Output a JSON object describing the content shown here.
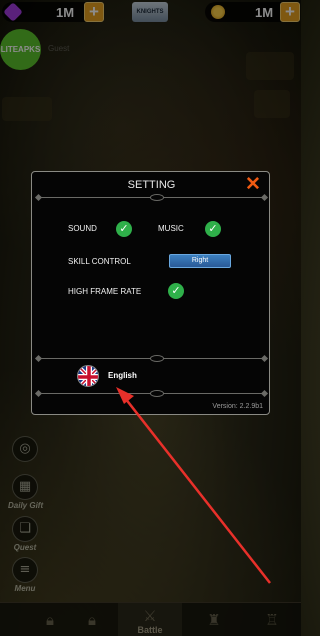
{
  "topbar": {
    "gems_value": "1M",
    "coins_value": "1M",
    "plus_label": "+",
    "logo_text": "KNIGHTS"
  },
  "watermark": {
    "text": "LITEAPKS"
  },
  "profile": {
    "guest_text": "Guest"
  },
  "side_menu": [
    {
      "label": "Daily Gift",
      "icon": "calendar-icon"
    },
    {
      "label": "Quest",
      "icon": "scroll-icon"
    },
    {
      "label": "Menu",
      "icon": "menu-icon"
    }
  ],
  "bottom_nav": {
    "battle_label": "Battle"
  },
  "dialog": {
    "title": "SETTING",
    "close_glyph": "✕",
    "sound_label": "SOUND",
    "music_label": "MUSIC",
    "skill_control_label": "SKILL CONTROL",
    "skill_control_value": "Right",
    "high_frame_rate_label": "HIGH FRAME RATE",
    "language": "English",
    "version": "Version: 2.2.9b1",
    "sound_enabled": true,
    "music_enabled": true,
    "high_frame_rate_enabled": true
  },
  "colors": {
    "accent_close": "#f05a12",
    "check_green": "#2fb04a",
    "button_blue": "#3c80c0",
    "arrow_red": "#e8302a"
  }
}
